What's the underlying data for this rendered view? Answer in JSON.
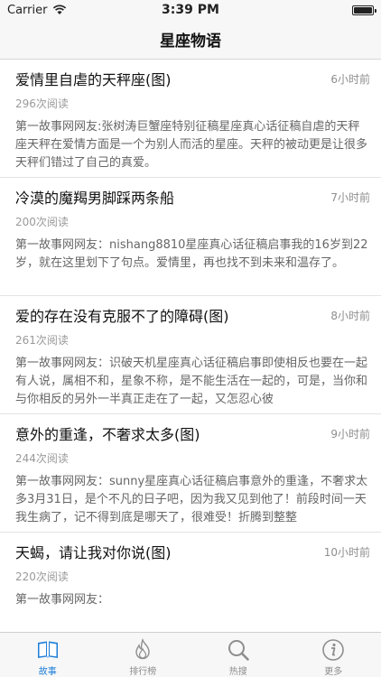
{
  "status_bar": {
    "carrier": "Carrier",
    "time": "3:39 PM",
    "battery_level": 1.0
  },
  "nav": {
    "title": "星座物语"
  },
  "articles": [
    {
      "title": "爱情里自虐的天秤座(图)",
      "time": "6小时前",
      "reads": "296次阅读",
      "summary": "第一故事网网友:张树涛巨蟹座特别征稿星座真心话征稿自虐的天秤座天秤在爱情方面是一个为别人而活的星座。天秤的被动更是让很多天秤们错过了自己的真爱。"
    },
    {
      "title": "冷漠的魔羯男脚踩两条船",
      "time": "7小时前",
      "reads": "200次阅读",
      "summary": "第一故事网网友：nishang8810星座真心话征稿启事我的16岁到22岁，就在这里划下了句点。爱情里，再也找不到未来和温存了。"
    },
    {
      "title": "爱的存在没有克服不了的障碍(图)",
      "time": "8小时前",
      "reads": "261次阅读",
      "summary": "第一故事网网友：识破天机星座真心话征稿启事即使相反也要在一起有人说，属相不和，星象不称，是不能生活在一起的，可是，当你和与你相反的另外一半真正走在了一起，又怎忍心彼"
    },
    {
      "title": "意外的重逢，不奢求太多(图)",
      "time": "9小时前",
      "reads": "244次阅读",
      "summary": "第一故事网网友：sunny星座真心话征稿启事意外的重逢，不奢求太多3月31日，是个不凡的日子吧，因为我又见到他了！前段时间一天我生病了，记不得到底是哪天了，很难受！折腾到整整"
    },
    {
      "title": "天蝎，请让我对你说(图)",
      "time": "10小时前",
      "reads": "220次阅读",
      "summary": "第一故事网网友："
    }
  ],
  "tabs": [
    {
      "label": "故事",
      "icon": "book-icon",
      "active": true
    },
    {
      "label": "排行榜",
      "icon": "flame-icon",
      "active": false
    },
    {
      "label": "热搜",
      "icon": "search-icon",
      "active": false
    },
    {
      "label": "更多",
      "icon": "info-icon",
      "active": false
    }
  ],
  "colors": {
    "accent": "#1e7fd9",
    "inactive": "#8e8e8e"
  }
}
